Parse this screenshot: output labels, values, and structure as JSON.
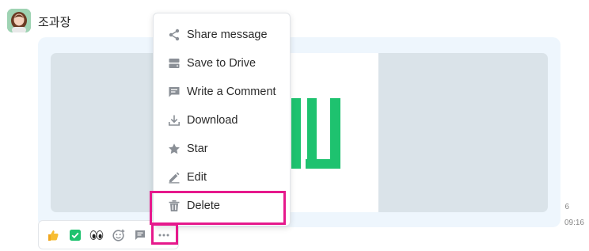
{
  "message": {
    "sender_name": "조과장",
    "read_count": "6",
    "time": "09:16"
  },
  "context_menu": {
    "items": [
      {
        "label": "Share message",
        "icon": "share-icon"
      },
      {
        "label": "Save to Drive",
        "icon": "drive-icon"
      },
      {
        "label": "Write a Comment",
        "icon": "comment-icon"
      },
      {
        "label": "Download",
        "icon": "download-icon"
      },
      {
        "label": "Star",
        "icon": "star-icon"
      },
      {
        "label": "Edit",
        "icon": "edit-icon"
      },
      {
        "label": "Delete",
        "icon": "trash-icon"
      }
    ]
  },
  "reactions": [
    "thumbs-up-icon",
    "checkbox-icon",
    "eyes-icon",
    "add-emoji-icon",
    "comment-icon",
    "more-icon"
  ],
  "colors": {
    "highlight": "#e6198c",
    "bubble": "#eef6fd",
    "preview_bg": "#dae3e9",
    "logo_green": "#1ec26f",
    "icon_gray": "#8a8f96"
  }
}
